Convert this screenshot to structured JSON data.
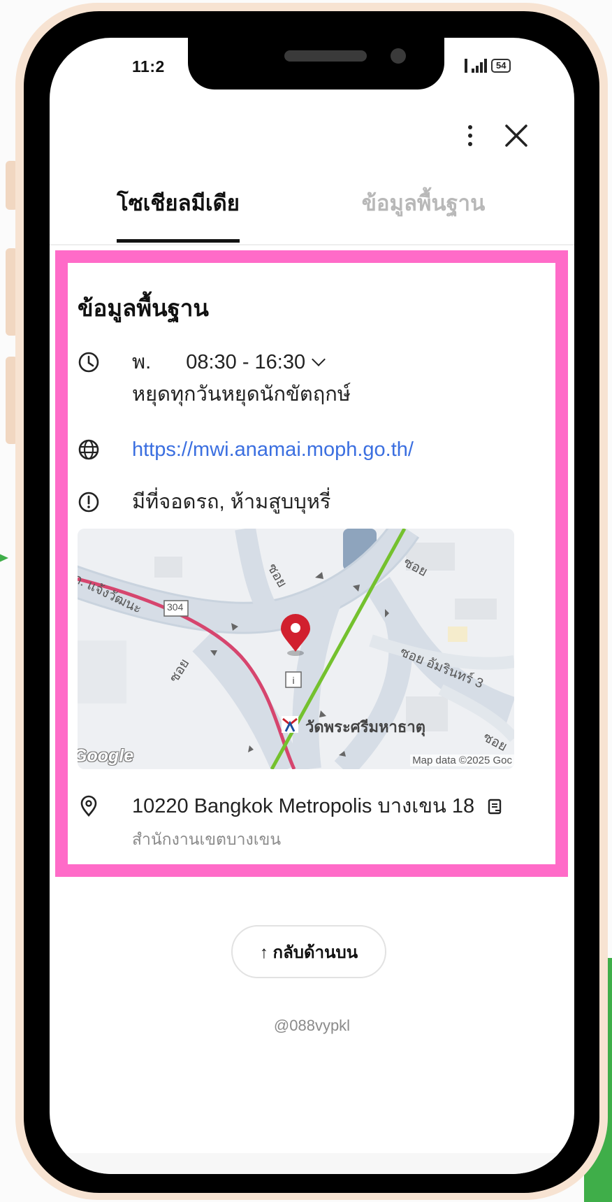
{
  "status_bar": {
    "time": "11:2",
    "battery": "54"
  },
  "tabs": [
    {
      "label": "โซเชียลมีเดีย",
      "active": true
    },
    {
      "label": "ข้อมูลพื้นฐาน",
      "active": false
    }
  ],
  "basic_info": {
    "title": "ข้อมูลพื้นฐาน",
    "hours": {
      "day": "พ.",
      "time": "08:30 - 16:30",
      "note": "หยุดทุกวันหยุดนักขัตฤกษ์"
    },
    "website": "https://mwi.anamai.moph.go.th/",
    "facilities": "มีที่จอดรถ, ห้ามสูบบุหรี่",
    "map": {
      "logo": "Google",
      "credit": "Map data ©2025 Goc",
      "place_label": "วัดพระศรีมหาธาตุ",
      "road_labels": [
        "ถ. แจ้งวัฒนะ",
        "ซอย",
        "ซอย",
        "ซอย",
        "ซอย อัมรินทร์ 3",
        "ซอย"
      ],
      "route_shield": "304"
    },
    "address": "10220 Bangkok Metropolis บางเขน 18",
    "address_sub": "สำนักงานเขตบางเขน"
  },
  "back_to_top": "↑ กลับด้านบน",
  "username": "@088vypkl",
  "colors": {
    "highlight": "#ff6bc8",
    "link": "#3b6fe0",
    "deco_green": "#3fae49",
    "phone_frame": "#f7e3d2"
  }
}
